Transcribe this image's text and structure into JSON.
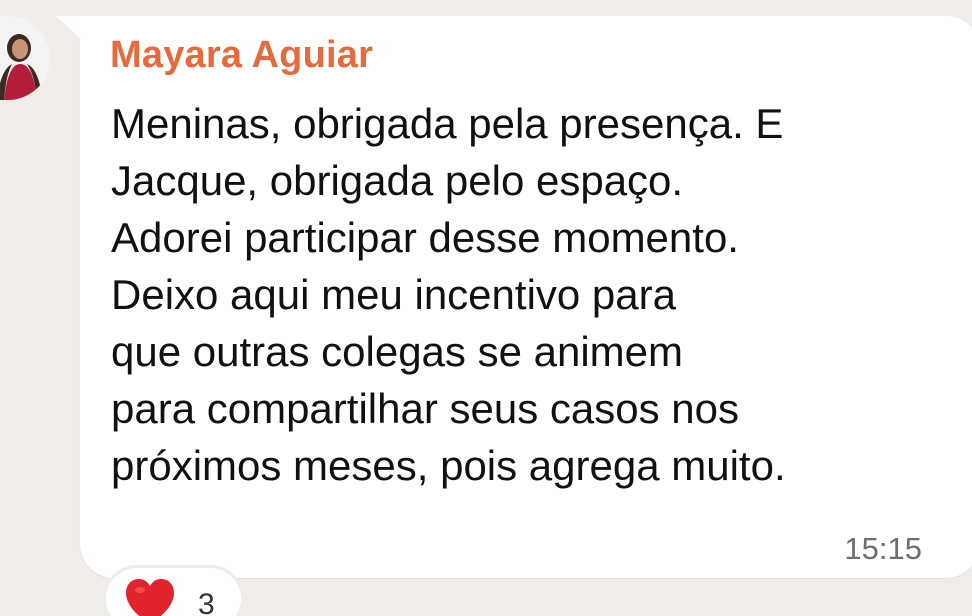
{
  "message": {
    "sender_name": "Mayara Aguiar",
    "lines": [
      "Meninas, obrigada pela presença. E",
      "Jacque, obrigada pelo espaço.",
      "Adorei participar desse momento.",
      "Deixo aqui meu incentivo para",
      "que outras colegas se animem",
      "para compartilhar seus casos nos",
      "próximos meses, pois agrega muito."
    ],
    "time": "15:15"
  },
  "reaction": {
    "icon": "heart-icon",
    "count": "3"
  },
  "colors": {
    "background": "#f0ede8",
    "bubble": "#ffffff",
    "sender": "#e56b3f",
    "text": "#111111",
    "time": "#6f6f6f",
    "heart": "#e0242d"
  }
}
